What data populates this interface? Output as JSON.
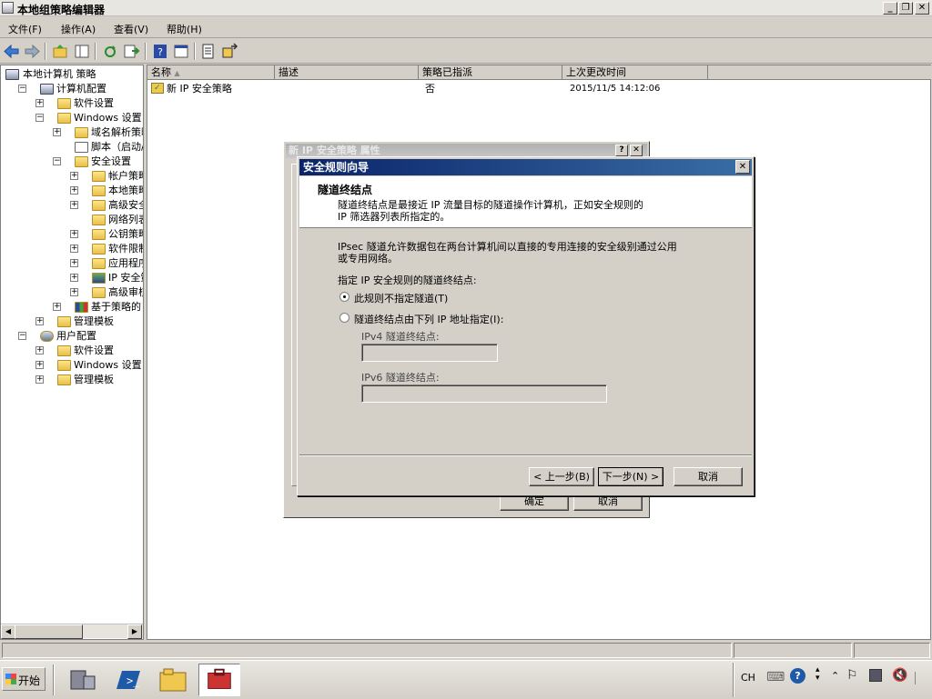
{
  "window": {
    "title": "本地组策略编辑器"
  },
  "menu": [
    "文件(F)",
    "操作(A)",
    "查看(V)",
    "帮助(H)"
  ],
  "tree": [
    {
      "label": "本地计算机 策略",
      "level": 0,
      "exp": "",
      "icon": "computer-icon"
    },
    {
      "label": "计算机配置",
      "level": 1,
      "exp": "−",
      "icon": "computer-config-icon"
    },
    {
      "label": "软件设置",
      "level": 2,
      "exp": "+",
      "icon": "folder-icon"
    },
    {
      "label": "Windows 设置",
      "level": 2,
      "exp": "−",
      "icon": "folder-icon"
    },
    {
      "label": "域名解析策略",
      "level": 3,
      "exp": "+",
      "icon": "folder-icon"
    },
    {
      "label": "脚本（启动/关",
      "level": 3,
      "exp": "",
      "icon": "script-icon"
    },
    {
      "label": "安全设置",
      "level": 3,
      "exp": "−",
      "icon": "security-icon"
    },
    {
      "label": "帐户策略",
      "level": 4,
      "exp": "+",
      "icon": "folder-lock-icon"
    },
    {
      "label": "本地策略",
      "level": 4,
      "exp": "+",
      "icon": "folder-lock-icon"
    },
    {
      "label": "高级安全",
      "level": 4,
      "exp": "+",
      "icon": "folder-icon"
    },
    {
      "label": "网络列表管",
      "level": 4,
      "exp": "",
      "icon": "folder-icon"
    },
    {
      "label": "公钥策略",
      "level": 4,
      "exp": "+",
      "icon": "folder-icon"
    },
    {
      "label": "软件限制策",
      "level": 4,
      "exp": "+",
      "icon": "folder-icon"
    },
    {
      "label": "应用程序控",
      "level": 4,
      "exp": "+",
      "icon": "folder-icon"
    },
    {
      "label": "IP 安全策",
      "level": 4,
      "exp": "+",
      "icon": "ip-security-icon"
    },
    {
      "label": "高级审核策",
      "level": 4,
      "exp": "+",
      "icon": "folder-icon"
    },
    {
      "label": "基于策略的 Q",
      "level": 3,
      "exp": "+",
      "icon": "chart-icon"
    },
    {
      "label": "管理模板",
      "level": 2,
      "exp": "+",
      "icon": "folder-icon"
    },
    {
      "label": "用户配置",
      "level": 1,
      "exp": "−",
      "icon": "user-config-icon"
    },
    {
      "label": "软件设置",
      "level": 2,
      "exp": "+",
      "icon": "folder-icon"
    },
    {
      "label": "Windows 设置",
      "level": 2,
      "exp": "+",
      "icon": "folder-icon"
    },
    {
      "label": "管理模板",
      "level": 2,
      "exp": "+",
      "icon": "folder-icon"
    }
  ],
  "list": {
    "columns": [
      "名称",
      "描述",
      "策略已指派",
      "上次更改时间"
    ],
    "rows": [
      {
        "name": "新 IP 安全策略",
        "desc": "",
        "assigned": "否",
        "modified": "2015/11/5 14:12:06"
      }
    ]
  },
  "props": {
    "title": "新 IP 安全策略 属性",
    "ok": "确定",
    "cancel": "取消"
  },
  "wizard": {
    "title": "安全规则向导",
    "heading": "隧道终结点",
    "subtitle1": "隧道终结点是最接近 IP 流量目标的隧道操作计算机，正如安全规则的",
    "subtitle2": "IP 筛选器列表所指定的。",
    "desc1": "IPsec 隧道允许数据包在两台计算机间以直接的专用连接的安全级别通过公用",
    "desc2": "或专用网络。",
    "prompt": "指定 IP 安全规则的隧道终结点:",
    "opt_none": "此规则不指定隧道(T)",
    "opt_ip": "隧道终结点由下列 IP 地址指定(I):",
    "ipv4_label": "IPv4 隧道终结点:",
    "ipv6_label": "IPv6 隧道终结点:",
    "back": "< 上一步(B)",
    "next": "下一步(N) >",
    "cancel": "取消"
  },
  "taskbar": {
    "start": "开始",
    "lang": "CH"
  }
}
